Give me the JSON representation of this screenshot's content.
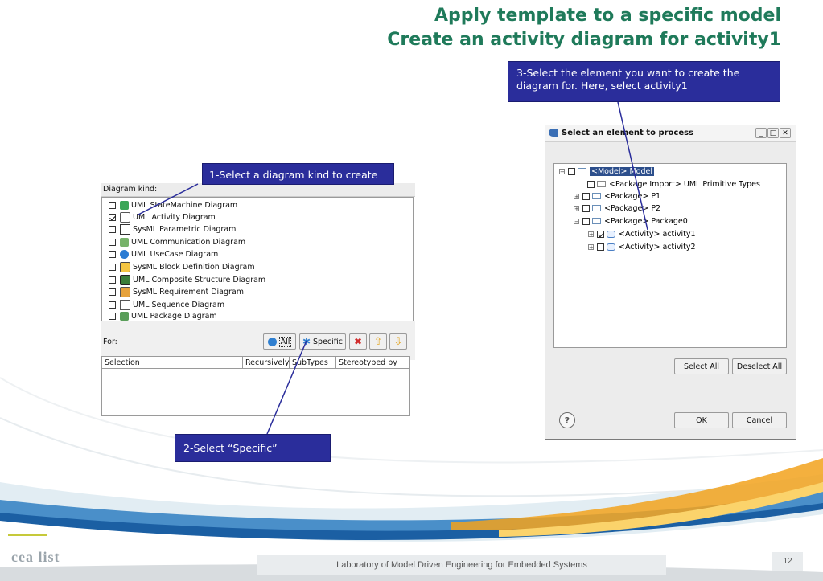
{
  "slide": {
    "title_line1": "Apply template to a specific model",
    "title_line2": "Create an activity diagram for activity1",
    "page_number": "12",
    "footer_text": "Laboratory of Model Driven Engineering for Embedded Systems",
    "logo_text": "cea list"
  },
  "callouts": {
    "step1": "1-Select a diagram kind to create",
    "step2": "2-Select “Specific”",
    "step3": "3-Select the element you want to create the diagram for. Here, select activity1"
  },
  "diagram_panel": {
    "label": "Diagram kind:",
    "items": [
      {
        "label": "UML StateMachine Diagram",
        "checked": false
      },
      {
        "label": "UML Activity Diagram",
        "checked": true
      },
      {
        "label": "SysML Parametric Diagram",
        "checked": false
      },
      {
        "label": "UML Communication Diagram",
        "checked": false
      },
      {
        "label": "UML UseCase Diagram",
        "checked": false
      },
      {
        "label": "SysML Block Definition Diagram",
        "checked": false
      },
      {
        "label": "UML Composite Structure Diagram",
        "checked": false
      },
      {
        "label": "SysML Requirement Diagram",
        "checked": false
      },
      {
        "label": "UML Sequence Diagram",
        "checked": false
      },
      {
        "label": "UML Package Diagram",
        "checked": false
      }
    ],
    "for_label": "For:",
    "all_button": "All",
    "specific_button": "Specific",
    "columns": [
      "Selection",
      "Recursively",
      "SubTypes",
      "Stereotyped by"
    ]
  },
  "dialog": {
    "title": "Select an element to process",
    "tree": [
      {
        "label": "<Model> Model",
        "checked": false,
        "selected": true
      },
      {
        "label": "<Package Import> UML Primitive Types",
        "checked": false
      },
      {
        "label": "<Package> P1",
        "checked": false
      },
      {
        "label": "<Package> P2",
        "checked": false
      },
      {
        "label": "<Package> Package0",
        "checked": false
      },
      {
        "label": "<Activity> activity1",
        "checked": true
      },
      {
        "label": "<Activity> activity2",
        "checked": false
      }
    ],
    "select_all": "Select All",
    "deselect_all": "Deselect All",
    "ok": "OK",
    "cancel": "Cancel"
  },
  "colors": {
    "title": "#1f7a5a",
    "callout_bg": "#2a2d9b",
    "accent_orange": "#f2a21c"
  }
}
